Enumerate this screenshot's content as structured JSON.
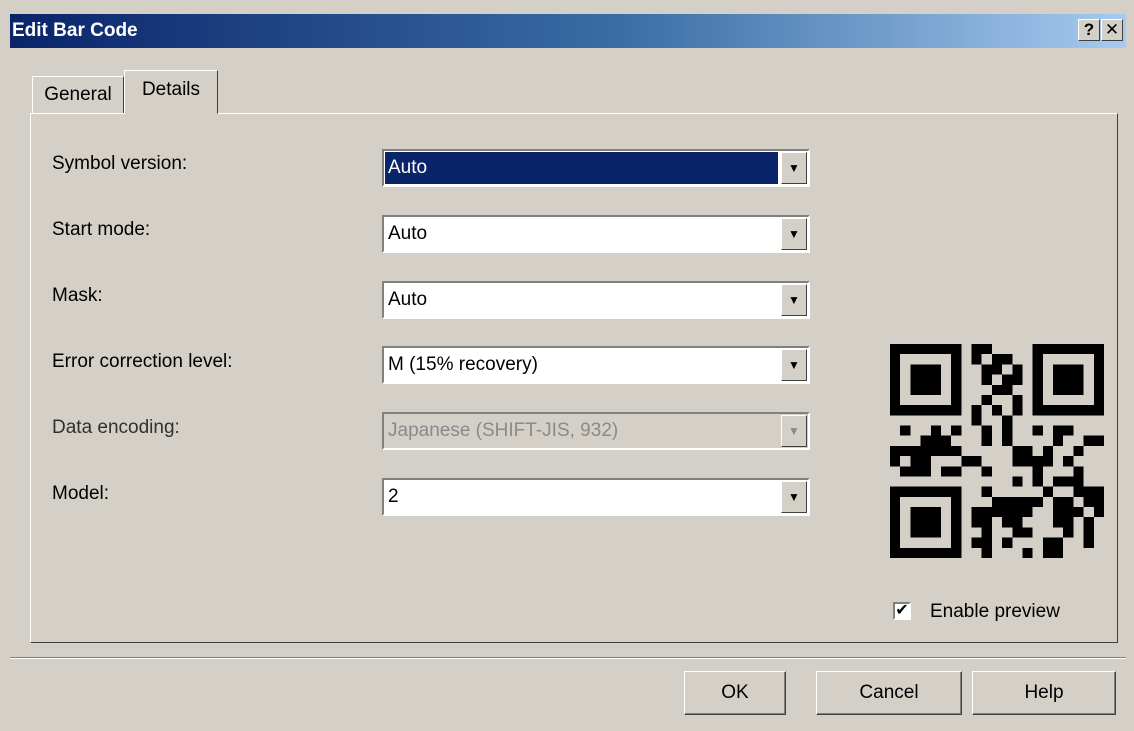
{
  "window": {
    "title": "Edit Bar Code",
    "help_button": "?",
    "close_button": "✕"
  },
  "tabs": [
    {
      "label": "General",
      "active": false
    },
    {
      "label": "Details",
      "active": true
    }
  ],
  "fields": {
    "symbol_version": {
      "label": "Symbol version:",
      "value": "Auto",
      "state": "focused"
    },
    "start_mode": {
      "label": "Start mode:",
      "value": "Auto"
    },
    "mask": {
      "label": "Mask:",
      "value": "Auto"
    },
    "error_correction": {
      "label": "Error correction level:",
      "value": "M (15% recovery)"
    },
    "data_encoding": {
      "label": "Data encoding:",
      "value": "Japanese (SHIFT-JIS, 932)",
      "state": "disabled"
    },
    "model": {
      "label": "Model:",
      "value": "2"
    }
  },
  "preview": {
    "icon": "qr-code-preview",
    "enable_label": "Enable preview",
    "enabled": true,
    "check_glyph": "✔"
  },
  "buttons": {
    "ok": "OK",
    "cancel": "Cancel",
    "help": "Help"
  },
  "dropdown_glyph": "▼"
}
